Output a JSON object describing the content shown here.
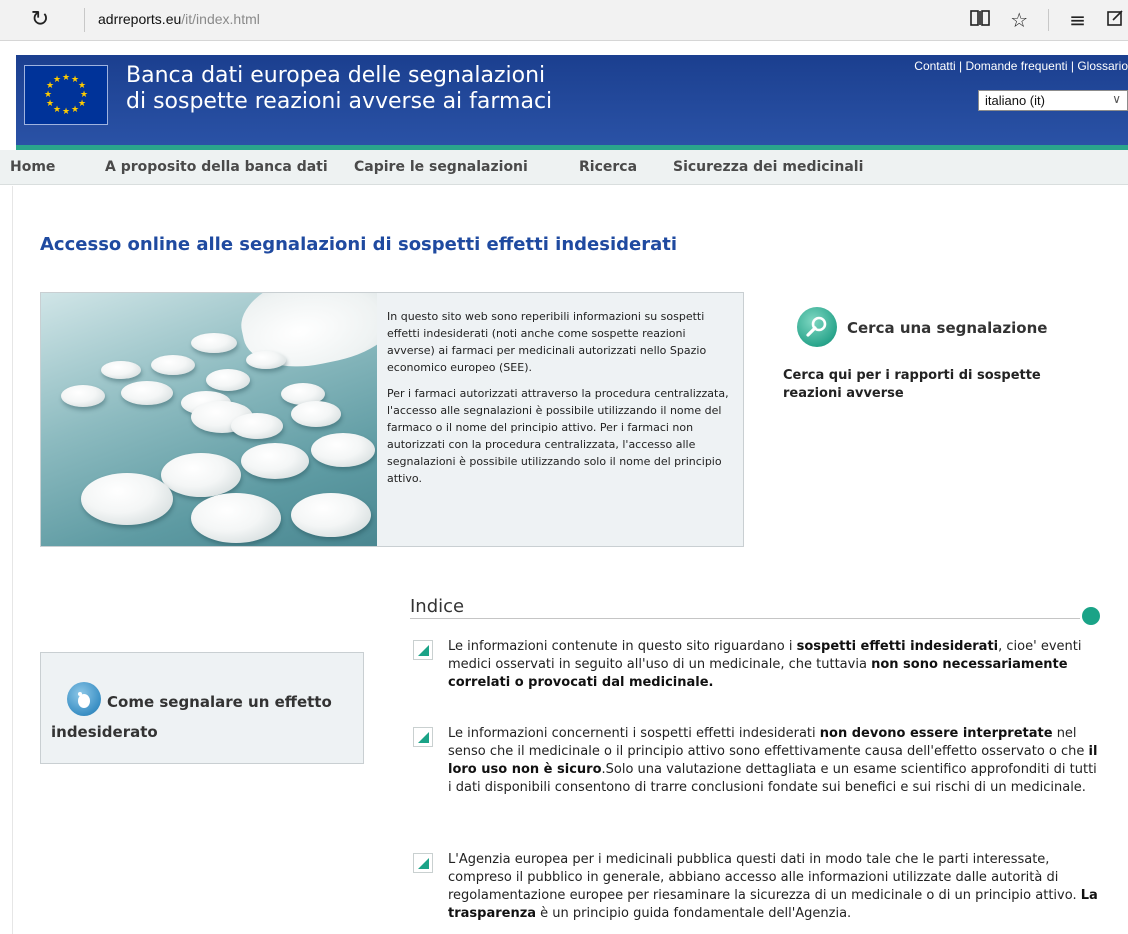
{
  "browser": {
    "url_domain": "adrreports.eu",
    "url_path": "/it/index.html",
    "icons": [
      "refresh-icon",
      "reading-view-icon",
      "favorite-star-icon",
      "hub-menu-icon",
      "web-note-icon"
    ]
  },
  "header": {
    "title_line1": "Banca dati europea delle segnalazioni",
    "title_line2": "di sospette reazioni avverse ai farmaci",
    "link_contacts": "Contatti",
    "link_faq": "Domande frequenti",
    "link_glossary": "Glossario",
    "link_sep": " | ",
    "language": "italiano (it)",
    "colors": {
      "header_blue": "#1b3f8f",
      "accent_teal": "#2aa58c"
    }
  },
  "nav": {
    "items": [
      {
        "label": "Home"
      },
      {
        "label": "A proposito della banca dati"
      },
      {
        "label": "Capire le segnalazioni"
      },
      {
        "label": "Ricerca"
      },
      {
        "label": "Sicurezza dei medicinali"
      }
    ]
  },
  "main": {
    "title": "Accesso online alle segnalazioni di sospetti effetti indesiderati",
    "intro_p1": "In questo sito web sono reperibili informazioni su sospetti effetti indesiderati (noti anche come sospette reazioni avverse) ai farmaci per medicinali autorizzati nello Spazio economico europeo (SEE).",
    "intro_p2": "Per i farmaci autorizzati attraverso la procedura centralizzata, l'accesso alle segnalazioni è possibile utilizzando il nome del farmaco o il nome del principio attivo. Per i farmaci non autorizzati con la procedura centralizzata, l'accesso alle segnalazioni è possibile utilizzando solo il nome del principio attivo.",
    "search_title": "Cerca una segnalazione",
    "search_desc": "Cerca qui per i rapporti di sospette reazioni avverse",
    "report_title": "Come segnalare un effetto indesiderato"
  },
  "index": {
    "title": "Indice",
    "p1": {
      "a": "Le informazioni contenute in questo sito riguardano i ",
      "b": "sospetti effetti indesiderati",
      "c": ", cioe' eventi medici osservati in seguito all'uso di un medicinale, che tuttavia ",
      "d": "non sono necessariamente correlati o provocati dal medicinale."
    },
    "p2": {
      "a": "Le informazioni concernenti i sospetti effetti indesiderati ",
      "b": "non devono essere interpretate",
      "c": " nel senso che il medicinale o il principio attivo sono effettivamente causa dell'effetto osservato o che ",
      "d": "il loro uso non è sicuro",
      "e": ".Solo una valutazione dettagliata e un esame scientifico approfonditi di tutti i dati disponibili consentono di trarre conclusioni fondate sui benefici e sui rischi di un medicinale."
    },
    "p3": {
      "a": "L'Agenzia europea per i medicinali pubblica questi dati in modo tale che le parti interessate, compreso il pubblico in generale, abbiano accesso alle informazioni utilizzate dalle autorità di regolamentazione europee per riesaminare la sicurezza di un medicinale o di un principio attivo. ",
      "b": "La trasparenza",
      "c": " è un principio guida fondamentale dell'Agenzia."
    }
  }
}
